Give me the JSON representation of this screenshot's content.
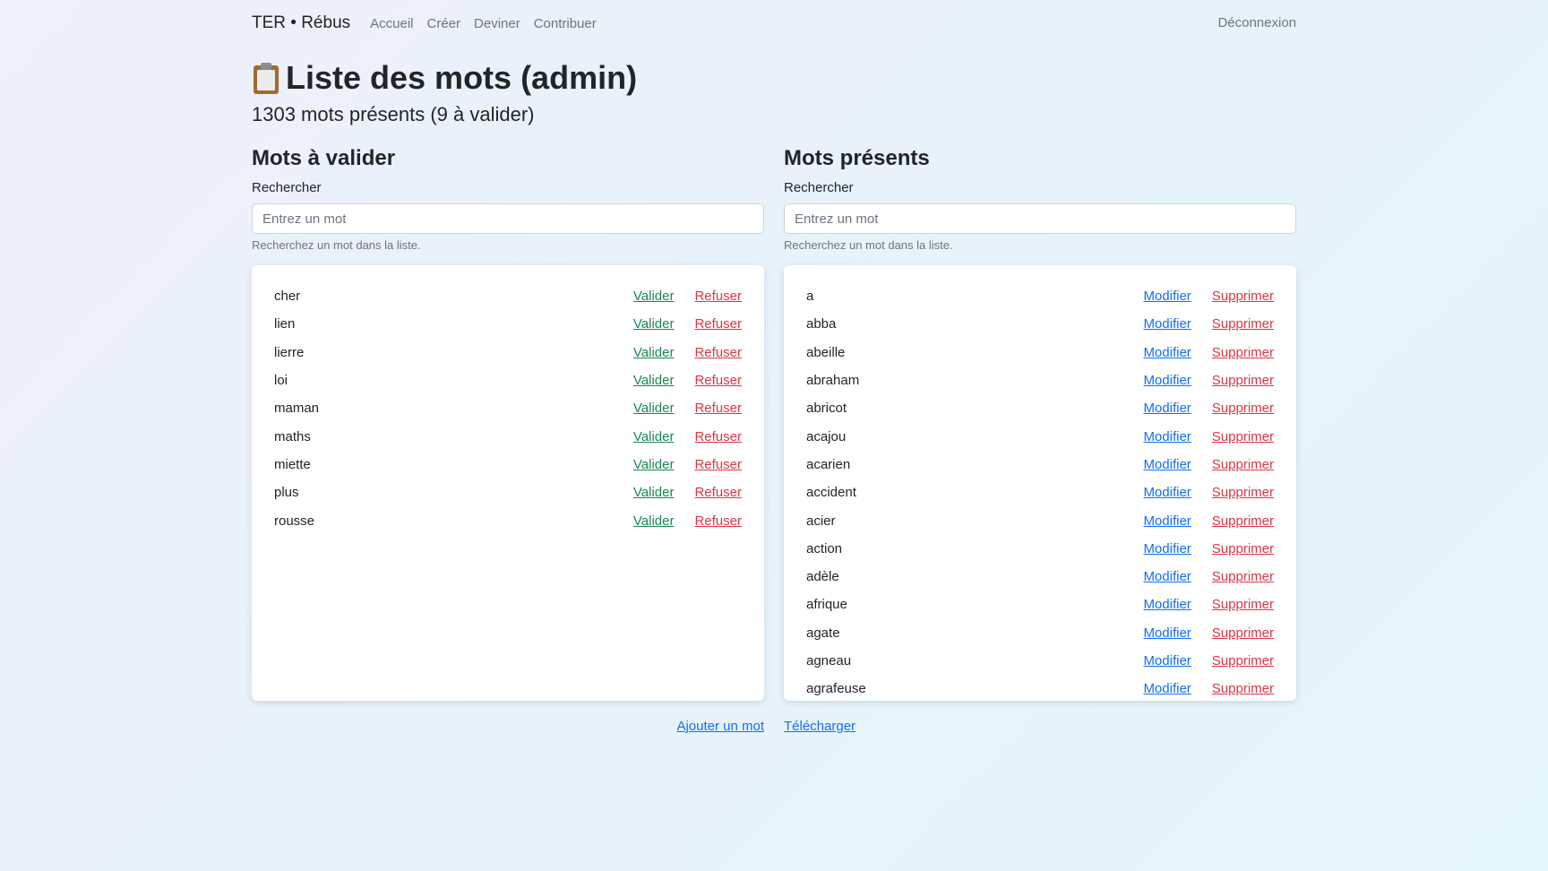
{
  "navbar": {
    "brand": "TER • Rébus",
    "links": [
      "Accueil",
      "Créer",
      "Deviner",
      "Contribuer"
    ],
    "logout": "Déconnexion"
  },
  "page": {
    "icon": "clipboard-icon",
    "title": "Liste des mots (admin)",
    "subtitle": "1303 mots présents (9 à valider)"
  },
  "pending": {
    "title": "Mots à valider",
    "search_label": "Rechercher",
    "search_placeholder": "Entrez un mot",
    "search_value": "",
    "help": "Recherchez un mot dans la liste.",
    "validate_label": "Valider",
    "reject_label": "Refuser",
    "words": [
      "cher",
      "lien",
      "lierre",
      "loi",
      "maman",
      "maths",
      "miette",
      "plus",
      "rousse"
    ]
  },
  "present": {
    "title": "Mots présents",
    "search_label": "Rechercher",
    "search_placeholder": "Entrez un mot",
    "search_value": "",
    "help": "Recherchez un mot dans la liste.",
    "edit_label": "Modifier",
    "delete_label": "Supprimer",
    "words": [
      "a",
      "abba",
      "abeille",
      "abraham",
      "abricot",
      "acajou",
      "acarien",
      "accident",
      "acier",
      "action",
      "adèle",
      "afrique",
      "agate",
      "agneau",
      "agrafeuse"
    ]
  },
  "footer": {
    "add_label": "Ajouter un mot",
    "download_label": "Télécharger"
  },
  "colors": {
    "validate": "#198754",
    "reject": "#dc3545",
    "link": "#0d6efd"
  }
}
